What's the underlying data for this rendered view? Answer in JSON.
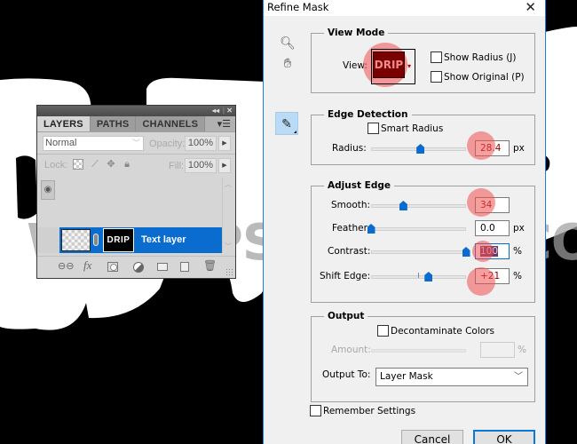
{
  "layers_panel": {
    "collapse_icon": "double-left-arrow",
    "close_icon": "close-x",
    "tabs": [
      {
        "label": "LAYERS",
        "active": true
      },
      {
        "label": "PATHS",
        "active": false
      },
      {
        "label": "CHANNELS",
        "active": false
      }
    ],
    "menu_icon": "panel-menu",
    "blend_mode": "Normal",
    "opacity_label": "Opacity:",
    "opacity_value": "100%",
    "lock_label": "Lock:",
    "fill_label": "Fill:",
    "fill_value": "100%",
    "layer": {
      "name": "Text layer",
      "mask_text": "DRIP",
      "visible": true,
      "selected": true
    },
    "bottom_icons": [
      "link-layers",
      "fx",
      "add-mask",
      "adjustment-layer",
      "new-group",
      "new-layer",
      "delete-layer"
    ]
  },
  "watermark": "WWW.PSD-DUDE.COM",
  "dialog": {
    "title": "Refine Mask",
    "tools": [
      "zoom-tool",
      "hand-tool",
      "refine-radius-tool"
    ],
    "view_mode": {
      "legend": "View Mode",
      "view_label": "View:",
      "view_thumb_text": "DRIP",
      "show_radius": {
        "label": "Show Radius (J)",
        "checked": false
      },
      "show_original": {
        "label": "Show Original (P)",
        "checked": false
      }
    },
    "edge_detection": {
      "legend": "Edge Detection",
      "smart_radius": {
        "label": "Smart Radius",
        "checked": false
      },
      "radius_label": "Radius:",
      "radius_value": "28.4",
      "radius_unit": "px",
      "radius_slider": 0.52
    },
    "adjust_edge": {
      "legend": "Adjust Edge",
      "smooth": {
        "label": "Smooth:",
        "value": "34",
        "unit": "",
        "slider": 0.34
      },
      "feather": {
        "label": "Feather:",
        "value": "0.0",
        "unit": "px",
        "slider": 0.0
      },
      "contrast": {
        "label": "Contrast:",
        "value": "100",
        "unit": "%",
        "slider": 1.0
      },
      "shift_edge": {
        "label": "Shift Edge:",
        "value": "+21",
        "unit": "%",
        "slider": 0.605
      }
    },
    "output": {
      "legend": "Output",
      "decontaminate": {
        "label": "Decontaminate Colors",
        "checked": false
      },
      "amount_label": "Amount:",
      "amount_value": "",
      "amount_unit": "%",
      "output_to_label": "Output To:",
      "output_to_value": "Layer Mask"
    },
    "remember_settings": {
      "label": "Remember Settings",
      "checked": false
    },
    "cancel_label": "Cancel",
    "ok_label": "OK"
  },
  "colors": {
    "accent": "#0a6ccf",
    "highlight": "#f05050",
    "dialog_bg": "#f0f0f0",
    "panel_bg": "#d6d6d6"
  }
}
